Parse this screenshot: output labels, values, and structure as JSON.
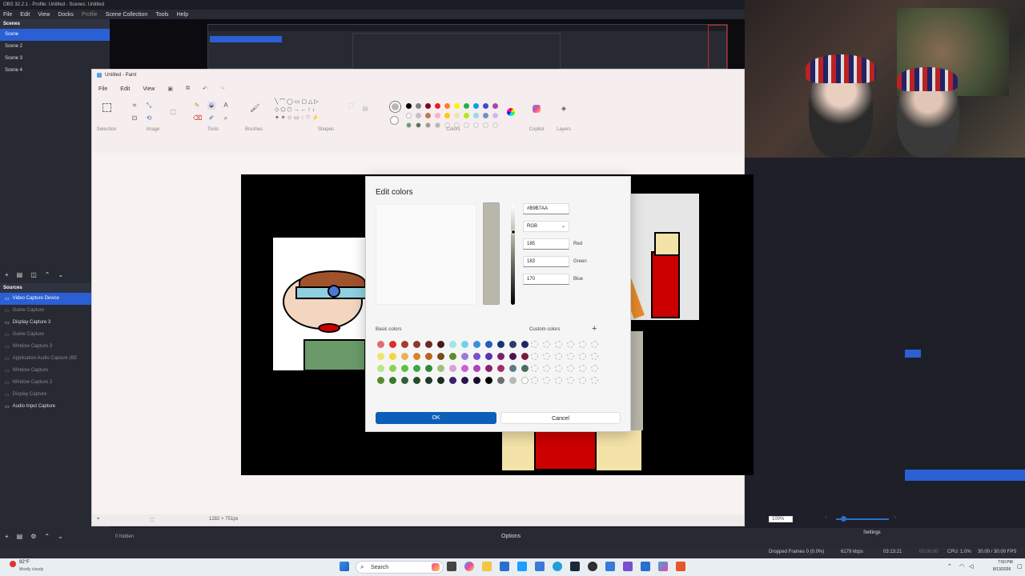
{
  "obs": {
    "title": "OBS 32.2.1 - Profile: Untitled - Scenes: Untitled",
    "menu": [
      "File",
      "Edit",
      "View",
      "Docks",
      "Profile",
      "Scene Collection",
      "Tools",
      "Help"
    ],
    "scenes_header": "Scenes",
    "scenes": [
      "Scene",
      "Scene 2",
      "Scene 3",
      "Scene 4"
    ],
    "sources_header": "Sources",
    "sources": [
      {
        "label": "Video Capture Device",
        "selected": true,
        "dim": false
      },
      {
        "label": "Game Capture",
        "selected": false,
        "dim": true
      },
      {
        "label": "Display Capture 3",
        "selected": false,
        "dim": false
      },
      {
        "label": "Game Capture",
        "selected": false,
        "dim": true
      },
      {
        "label": "Window Capture 3",
        "selected": false,
        "dim": true
      },
      {
        "label": "Application Audio Capture (BE",
        "selected": false,
        "dim": true
      },
      {
        "label": "Window Capture",
        "selected": false,
        "dim": true
      },
      {
        "label": "Window Capture 2",
        "selected": false,
        "dim": true
      },
      {
        "label": "Display Capture",
        "selected": false,
        "dim": true
      },
      {
        "label": "Audio Input Capture",
        "selected": false,
        "dim": false
      }
    ],
    "hidden_count": "0 hidden",
    "options_label": "Options",
    "settings_label": "Settings",
    "status": {
      "dropped": "Dropped Frames 0 (0.0%)",
      "kbps": "6179 kbps",
      "rec_time": "03:13:21",
      "stream_time": "00:00:00",
      "cpu": "CPU: 1.0%",
      "fps": "30.00 / 30.00 FPS"
    }
  },
  "paint": {
    "title": "Untitled - Paint",
    "menu": [
      "File",
      "Edit",
      "View"
    ],
    "groups": [
      "Selection",
      "Image",
      "Tools",
      "Brushes",
      "Shapes",
      "Colors",
      "Copilot",
      "Layers"
    ],
    "canvas_size": "1282 × 751px",
    "zoom": "100%"
  },
  "dialog": {
    "title": "Edit colors",
    "hex": "#B9B7AA",
    "mode": "RGB",
    "red": "185",
    "green": "183",
    "blue": "170",
    "red_label": "Red",
    "green_label": "Green",
    "blue_label": "Blue",
    "basic_label": "Basic colors",
    "custom_label": "Custom colors",
    "ok": "OK",
    "cancel": "Cancel",
    "current_color": "#b9b7aa",
    "basic_colors": [
      "#e06c75",
      "#d9302c",
      "#a83a2f",
      "#8a3b2b",
      "#6b2b1f",
      "#4a1c14",
      "#9ee6e6",
      "#6fd3e8",
      "#3c8fd9",
      "#1f5fbf",
      "#14337a",
      "#2a3a6e",
      "#1c2860",
      "#f2e36b",
      "#f5d63a",
      "#e8b058",
      "#d9822b",
      "#b5651d",
      "#7a4a1a",
      "#5e8c2e",
      "#9b7ad9",
      "#7a4fd0",
      "#5a2fb0",
      "#7a1f6e",
      "#4a1450",
      "#7a1a3a",
      "#b8e68a",
      "#8fd34a",
      "#5ec23a",
      "#3ba84a",
      "#2e8a3a",
      "#9fbf7a",
      "#d9a0d9",
      "#cf5fd3",
      "#b03fb8",
      "#8a1f6e",
      "#a82a6e",
      "#5e7a8a",
      "#4a6e5e",
      "#5a8a2e",
      "#3a7a2a",
      "#2e5e3a",
      "#2a4a2a",
      "#1f3a2a",
      "#1a2e1f",
      "#3a1f6e",
      "#2a1450",
      "#1a0a2e",
      "#000000",
      "#6e6e6e",
      "#b8b8b8",
      "#ffffff"
    ]
  },
  "taskbar": {
    "weather_temp": "92°F",
    "weather_desc": "Mostly cloudy",
    "search": "Search",
    "time": "7:50 PM",
    "date": "8/13/2026"
  }
}
